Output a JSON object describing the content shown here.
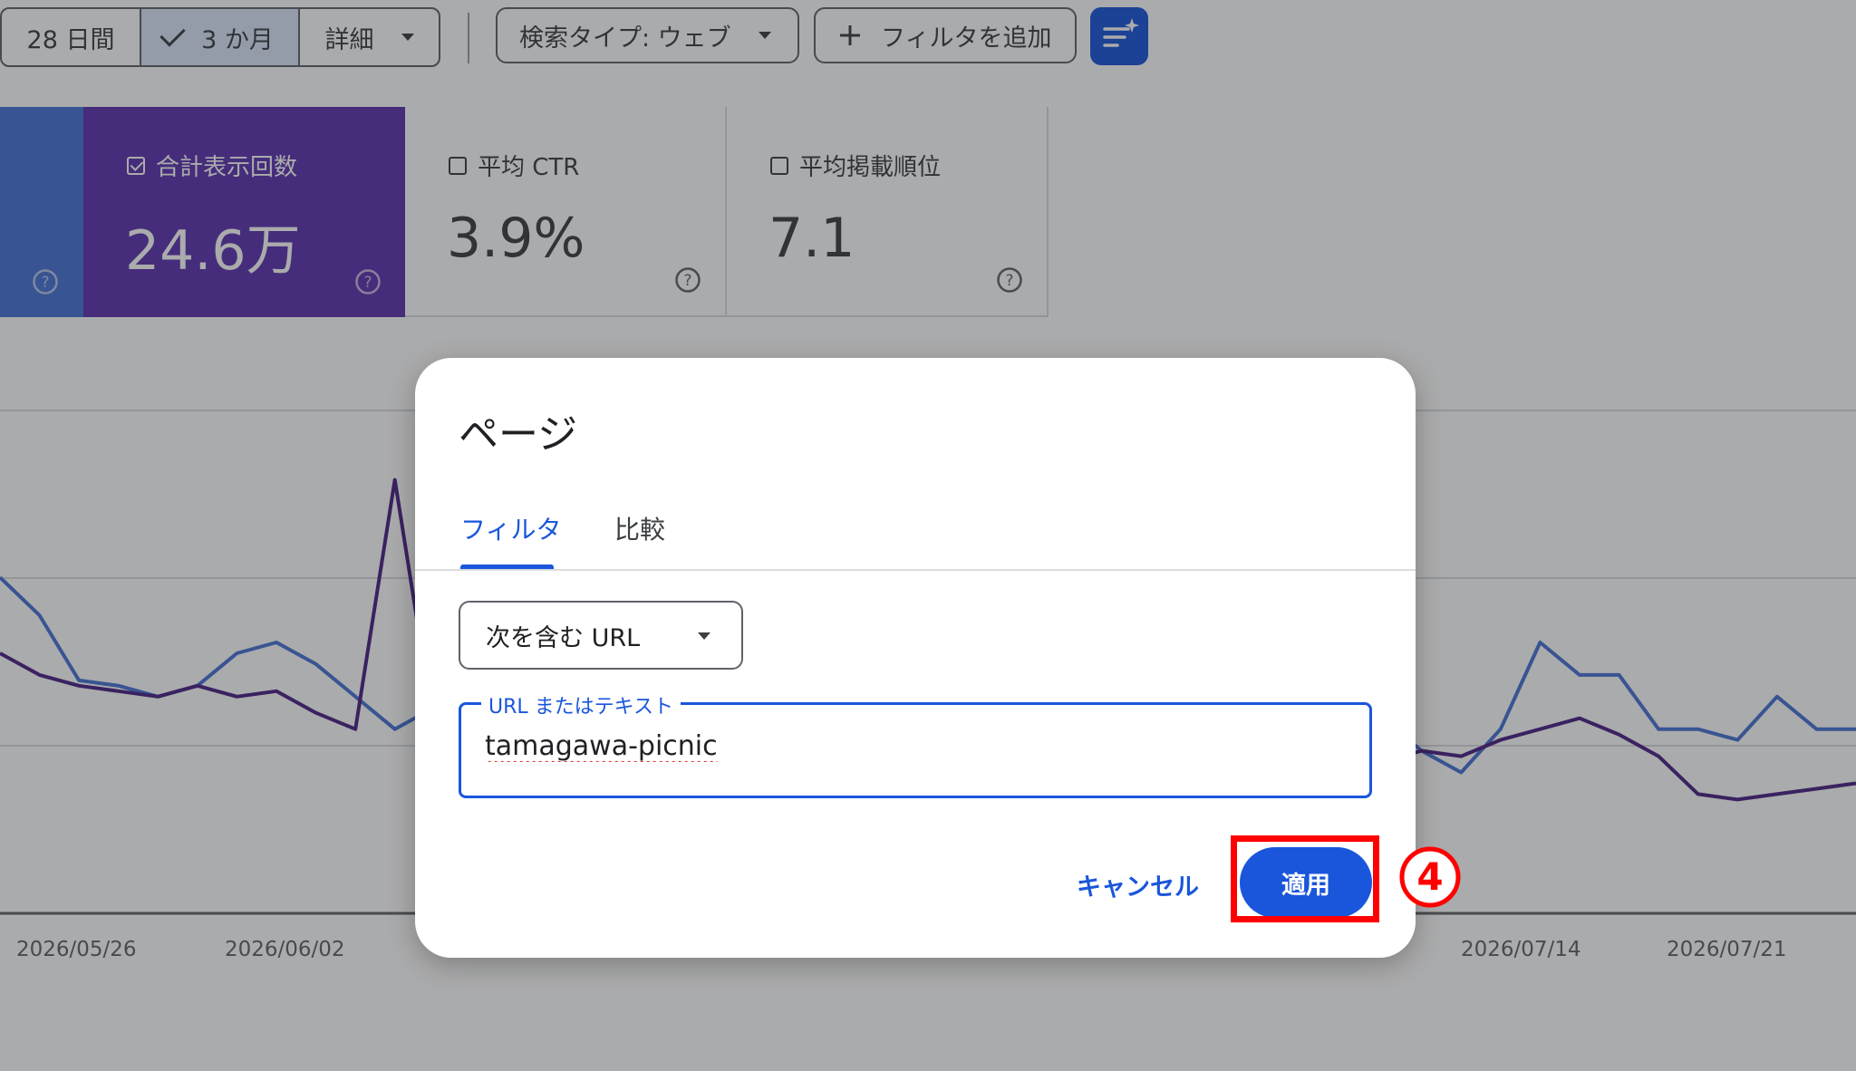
{
  "toolbar": {
    "date_range": [
      {
        "label": "28 日間",
        "selected": false
      },
      {
        "label": "3 か月",
        "selected": true
      },
      {
        "label": "詳細",
        "selected": false
      }
    ],
    "search_type_label": "検索タイプ: ウェブ",
    "add_filter_label": "フィルタを追加"
  },
  "metrics": [
    {
      "label": "合計表示回数",
      "value": "24.6万",
      "checked": true,
      "color": "#5e35b1"
    },
    {
      "label": "平均 CTR",
      "value": "3.9%",
      "checked": false
    },
    {
      "label": "平均掲載順位",
      "value": "7.1",
      "checked": false
    }
  ],
  "chart_data": {
    "type": "line",
    "x_tick_labels": [
      "2026/05/26",
      "2026/06/02",
      "2026/07/14",
      "2026/07/21"
    ],
    "series": [
      {
        "color": "#4a73d6",
        "values": [
          62,
          55,
          43,
          42,
          40,
          42,
          48,
          50,
          46,
          40,
          34,
          38,
          36,
          48,
          52,
          40,
          36,
          28,
          36,
          30,
          32,
          34,
          28,
          26,
          30,
          34,
          38,
          40,
          38,
          36,
          34,
          40,
          60,
          46,
          46,
          36,
          30,
          26,
          34,
          50,
          44,
          44,
          34,
          34,
          32,
          40,
          34,
          34
        ]
      },
      {
        "color": "#4b2387",
        "values": [
          48,
          44,
          42,
          41,
          40,
          42,
          40,
          41,
          37,
          34,
          80,
          34,
          38,
          42,
          44,
          40,
          36,
          30,
          34,
          30,
          30,
          32,
          30,
          28,
          30,
          32,
          34,
          36,
          34,
          32,
          30,
          32,
          33,
          31,
          33,
          28,
          30,
          29,
          32,
          34,
          36,
          33,
          29,
          22,
          21,
          22,
          23,
          24
        ]
      }
    ]
  },
  "dialog": {
    "title": "ページ",
    "tabs": {
      "filter": "フィルタ",
      "compare": "比較"
    },
    "match_type": "次を含む URL",
    "field_label": "URL またはテキスト",
    "field_value": "tamagawa-picnic",
    "cancel_label": "キャンセル",
    "apply_label": "適用"
  },
  "annotation": {
    "step_label": "4",
    "color": "#ff0000"
  }
}
